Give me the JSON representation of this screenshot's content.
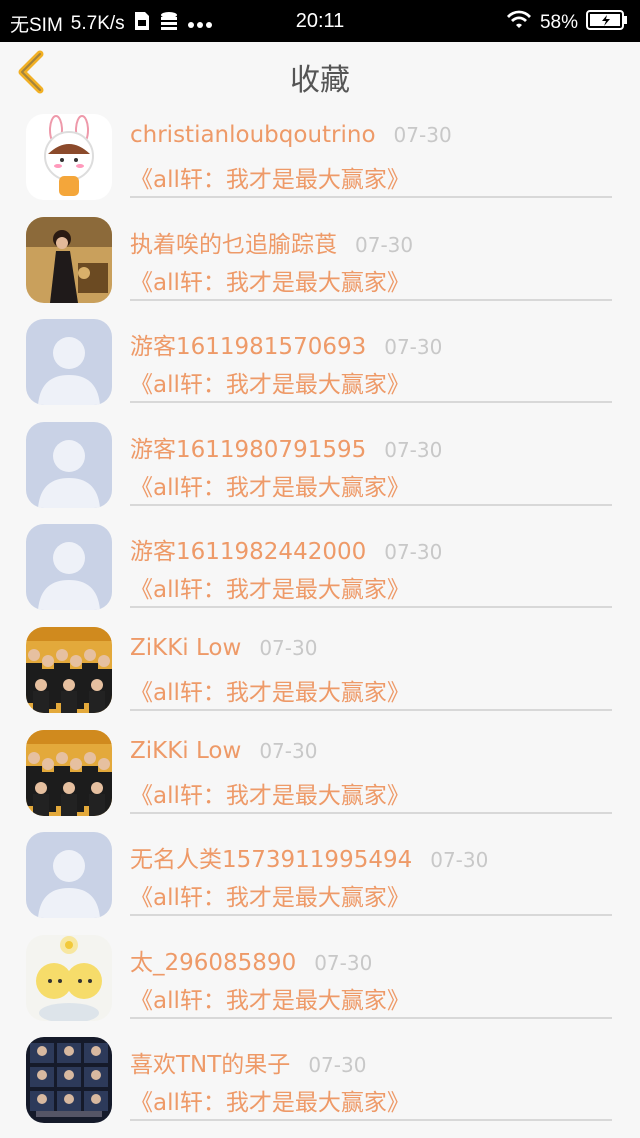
{
  "status_bar": {
    "carrier": "无SIM",
    "speed": "5.7K/s",
    "time": "20:11",
    "battery": "58%",
    "icons": [
      "sim-card-icon",
      "database-icon",
      "more-dots-icon",
      "wifi-icon",
      "battery-icon"
    ]
  },
  "nav": {
    "title": "收藏",
    "back_icon": "chevron-left-icon",
    "accent": "#f2b024"
  },
  "colors": {
    "name": "#ee9a68",
    "date": "#c8c8c8",
    "work": "#ee9a68",
    "divider": "#d8d8d8"
  },
  "items": [
    {
      "name": "christianloubqoutrino",
      "date": "07-30",
      "work": "《all轩：我才是最大赢家》",
      "avatar": "bunny-girl-avatar"
    },
    {
      "name": "执着唉的乜追腧踪莨",
      "date": "07-30",
      "work": "《all轩：我才是最大赢家》",
      "avatar": "photo-woman-avatar"
    },
    {
      "name": "游客1611981570693",
      "date": "07-30",
      "work": "《all轩：我才是最大赢家》",
      "avatar": "default-person-avatar"
    },
    {
      "name": "游客1611980791595",
      "date": "07-30",
      "work": "《all轩：我才是最大赢家》",
      "avatar": "default-person-avatar"
    },
    {
      "name": "游客1611982442000",
      "date": "07-30",
      "work": "《all轩：我才是最大赢家》",
      "avatar": "default-person-avatar"
    },
    {
      "name": "ZiKKi Low",
      "date": "07-30",
      "work": "《all轩：我才是最大赢家》",
      "avatar": "group-photo-avatar"
    },
    {
      "name": "ZiKKi Low",
      "date": "07-30",
      "work": "《all轩：我才是最大赢家》",
      "avatar": "group-photo-avatar"
    },
    {
      "name": "无名人类1573911995494",
      "date": "07-30",
      "work": "《all轩：我才是最大赢家》",
      "avatar": "default-person-avatar"
    },
    {
      "name": "太_296085890",
      "date": "07-30",
      "work": "《all轩：我才是最大赢家》",
      "avatar": "anime-pikachu-avatar"
    },
    {
      "name": "喜欢TNT的果子",
      "date": "07-30",
      "work": "《all轩：我才是最大赢家》",
      "avatar": "group-photo-dark-avatar"
    }
  ]
}
